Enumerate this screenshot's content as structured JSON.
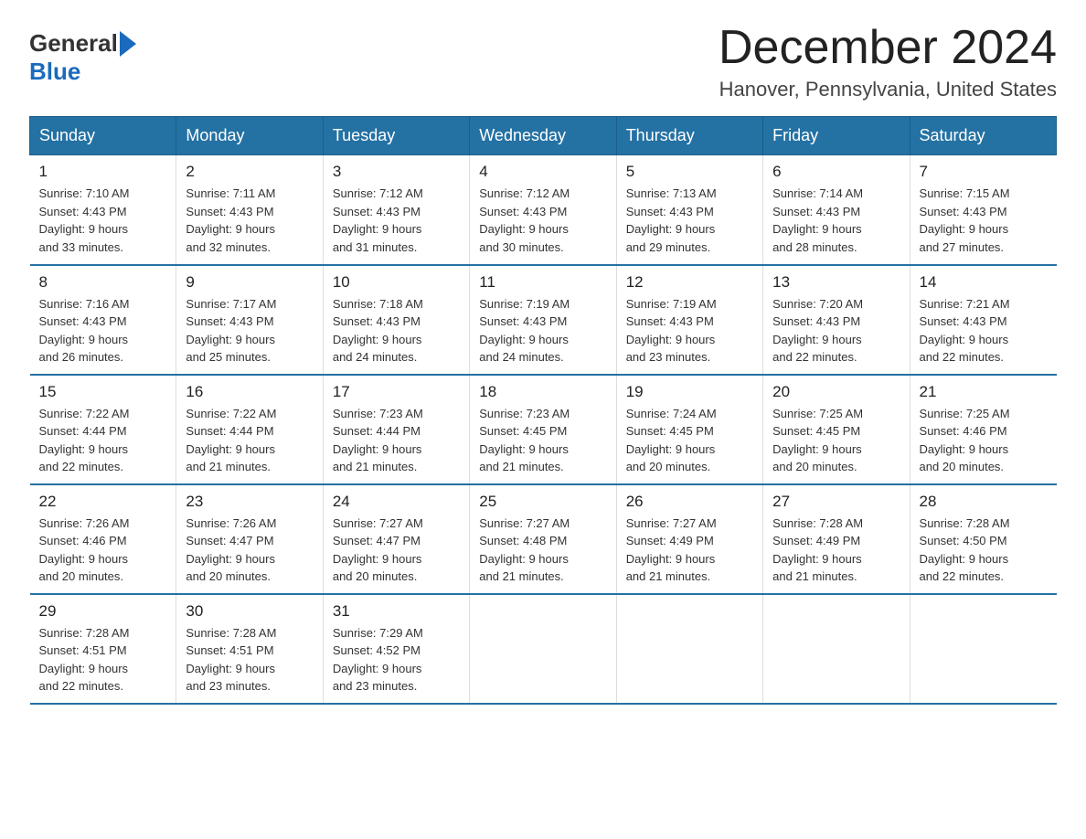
{
  "header": {
    "title": "December 2024",
    "subtitle": "Hanover, Pennsylvania, United States",
    "logo_general": "General",
    "logo_blue": "Blue"
  },
  "weekdays": [
    "Sunday",
    "Monday",
    "Tuesday",
    "Wednesday",
    "Thursday",
    "Friday",
    "Saturday"
  ],
  "weeks": [
    [
      {
        "day": "1",
        "sunrise": "7:10 AM",
        "sunset": "4:43 PM",
        "daylight": "9 hours and 33 minutes."
      },
      {
        "day": "2",
        "sunrise": "7:11 AM",
        "sunset": "4:43 PM",
        "daylight": "9 hours and 32 minutes."
      },
      {
        "day": "3",
        "sunrise": "7:12 AM",
        "sunset": "4:43 PM",
        "daylight": "9 hours and 31 minutes."
      },
      {
        "day": "4",
        "sunrise": "7:12 AM",
        "sunset": "4:43 PM",
        "daylight": "9 hours and 30 minutes."
      },
      {
        "day": "5",
        "sunrise": "7:13 AM",
        "sunset": "4:43 PM",
        "daylight": "9 hours and 29 minutes."
      },
      {
        "day": "6",
        "sunrise": "7:14 AM",
        "sunset": "4:43 PM",
        "daylight": "9 hours and 28 minutes."
      },
      {
        "day": "7",
        "sunrise": "7:15 AM",
        "sunset": "4:43 PM",
        "daylight": "9 hours and 27 minutes."
      }
    ],
    [
      {
        "day": "8",
        "sunrise": "7:16 AM",
        "sunset": "4:43 PM",
        "daylight": "9 hours and 26 minutes."
      },
      {
        "day": "9",
        "sunrise": "7:17 AM",
        "sunset": "4:43 PM",
        "daylight": "9 hours and 25 minutes."
      },
      {
        "day": "10",
        "sunrise": "7:18 AM",
        "sunset": "4:43 PM",
        "daylight": "9 hours and 24 minutes."
      },
      {
        "day": "11",
        "sunrise": "7:19 AM",
        "sunset": "4:43 PM",
        "daylight": "9 hours and 24 minutes."
      },
      {
        "day": "12",
        "sunrise": "7:19 AM",
        "sunset": "4:43 PM",
        "daylight": "9 hours and 23 minutes."
      },
      {
        "day": "13",
        "sunrise": "7:20 AM",
        "sunset": "4:43 PM",
        "daylight": "9 hours and 22 minutes."
      },
      {
        "day": "14",
        "sunrise": "7:21 AM",
        "sunset": "4:43 PM",
        "daylight": "9 hours and 22 minutes."
      }
    ],
    [
      {
        "day": "15",
        "sunrise": "7:22 AM",
        "sunset": "4:44 PM",
        "daylight": "9 hours and 22 minutes."
      },
      {
        "day": "16",
        "sunrise": "7:22 AM",
        "sunset": "4:44 PM",
        "daylight": "9 hours and 21 minutes."
      },
      {
        "day": "17",
        "sunrise": "7:23 AM",
        "sunset": "4:44 PM",
        "daylight": "9 hours and 21 minutes."
      },
      {
        "day": "18",
        "sunrise": "7:23 AM",
        "sunset": "4:45 PM",
        "daylight": "9 hours and 21 minutes."
      },
      {
        "day": "19",
        "sunrise": "7:24 AM",
        "sunset": "4:45 PM",
        "daylight": "9 hours and 20 minutes."
      },
      {
        "day": "20",
        "sunrise": "7:25 AM",
        "sunset": "4:45 PM",
        "daylight": "9 hours and 20 minutes."
      },
      {
        "day": "21",
        "sunrise": "7:25 AM",
        "sunset": "4:46 PM",
        "daylight": "9 hours and 20 minutes."
      }
    ],
    [
      {
        "day": "22",
        "sunrise": "7:26 AM",
        "sunset": "4:46 PM",
        "daylight": "9 hours and 20 minutes."
      },
      {
        "day": "23",
        "sunrise": "7:26 AM",
        "sunset": "4:47 PM",
        "daylight": "9 hours and 20 minutes."
      },
      {
        "day": "24",
        "sunrise": "7:27 AM",
        "sunset": "4:47 PM",
        "daylight": "9 hours and 20 minutes."
      },
      {
        "day": "25",
        "sunrise": "7:27 AM",
        "sunset": "4:48 PM",
        "daylight": "9 hours and 21 minutes."
      },
      {
        "day": "26",
        "sunrise": "7:27 AM",
        "sunset": "4:49 PM",
        "daylight": "9 hours and 21 minutes."
      },
      {
        "day": "27",
        "sunrise": "7:28 AM",
        "sunset": "4:49 PM",
        "daylight": "9 hours and 21 minutes."
      },
      {
        "day": "28",
        "sunrise": "7:28 AM",
        "sunset": "4:50 PM",
        "daylight": "9 hours and 22 minutes."
      }
    ],
    [
      {
        "day": "29",
        "sunrise": "7:28 AM",
        "sunset": "4:51 PM",
        "daylight": "9 hours and 22 minutes."
      },
      {
        "day": "30",
        "sunrise": "7:28 AM",
        "sunset": "4:51 PM",
        "daylight": "9 hours and 23 minutes."
      },
      {
        "day": "31",
        "sunrise": "7:29 AM",
        "sunset": "4:52 PM",
        "daylight": "9 hours and 23 minutes."
      },
      null,
      null,
      null,
      null
    ]
  ],
  "labels": {
    "sunrise": "Sunrise: ",
    "sunset": "Sunset: ",
    "daylight": "Daylight: "
  }
}
